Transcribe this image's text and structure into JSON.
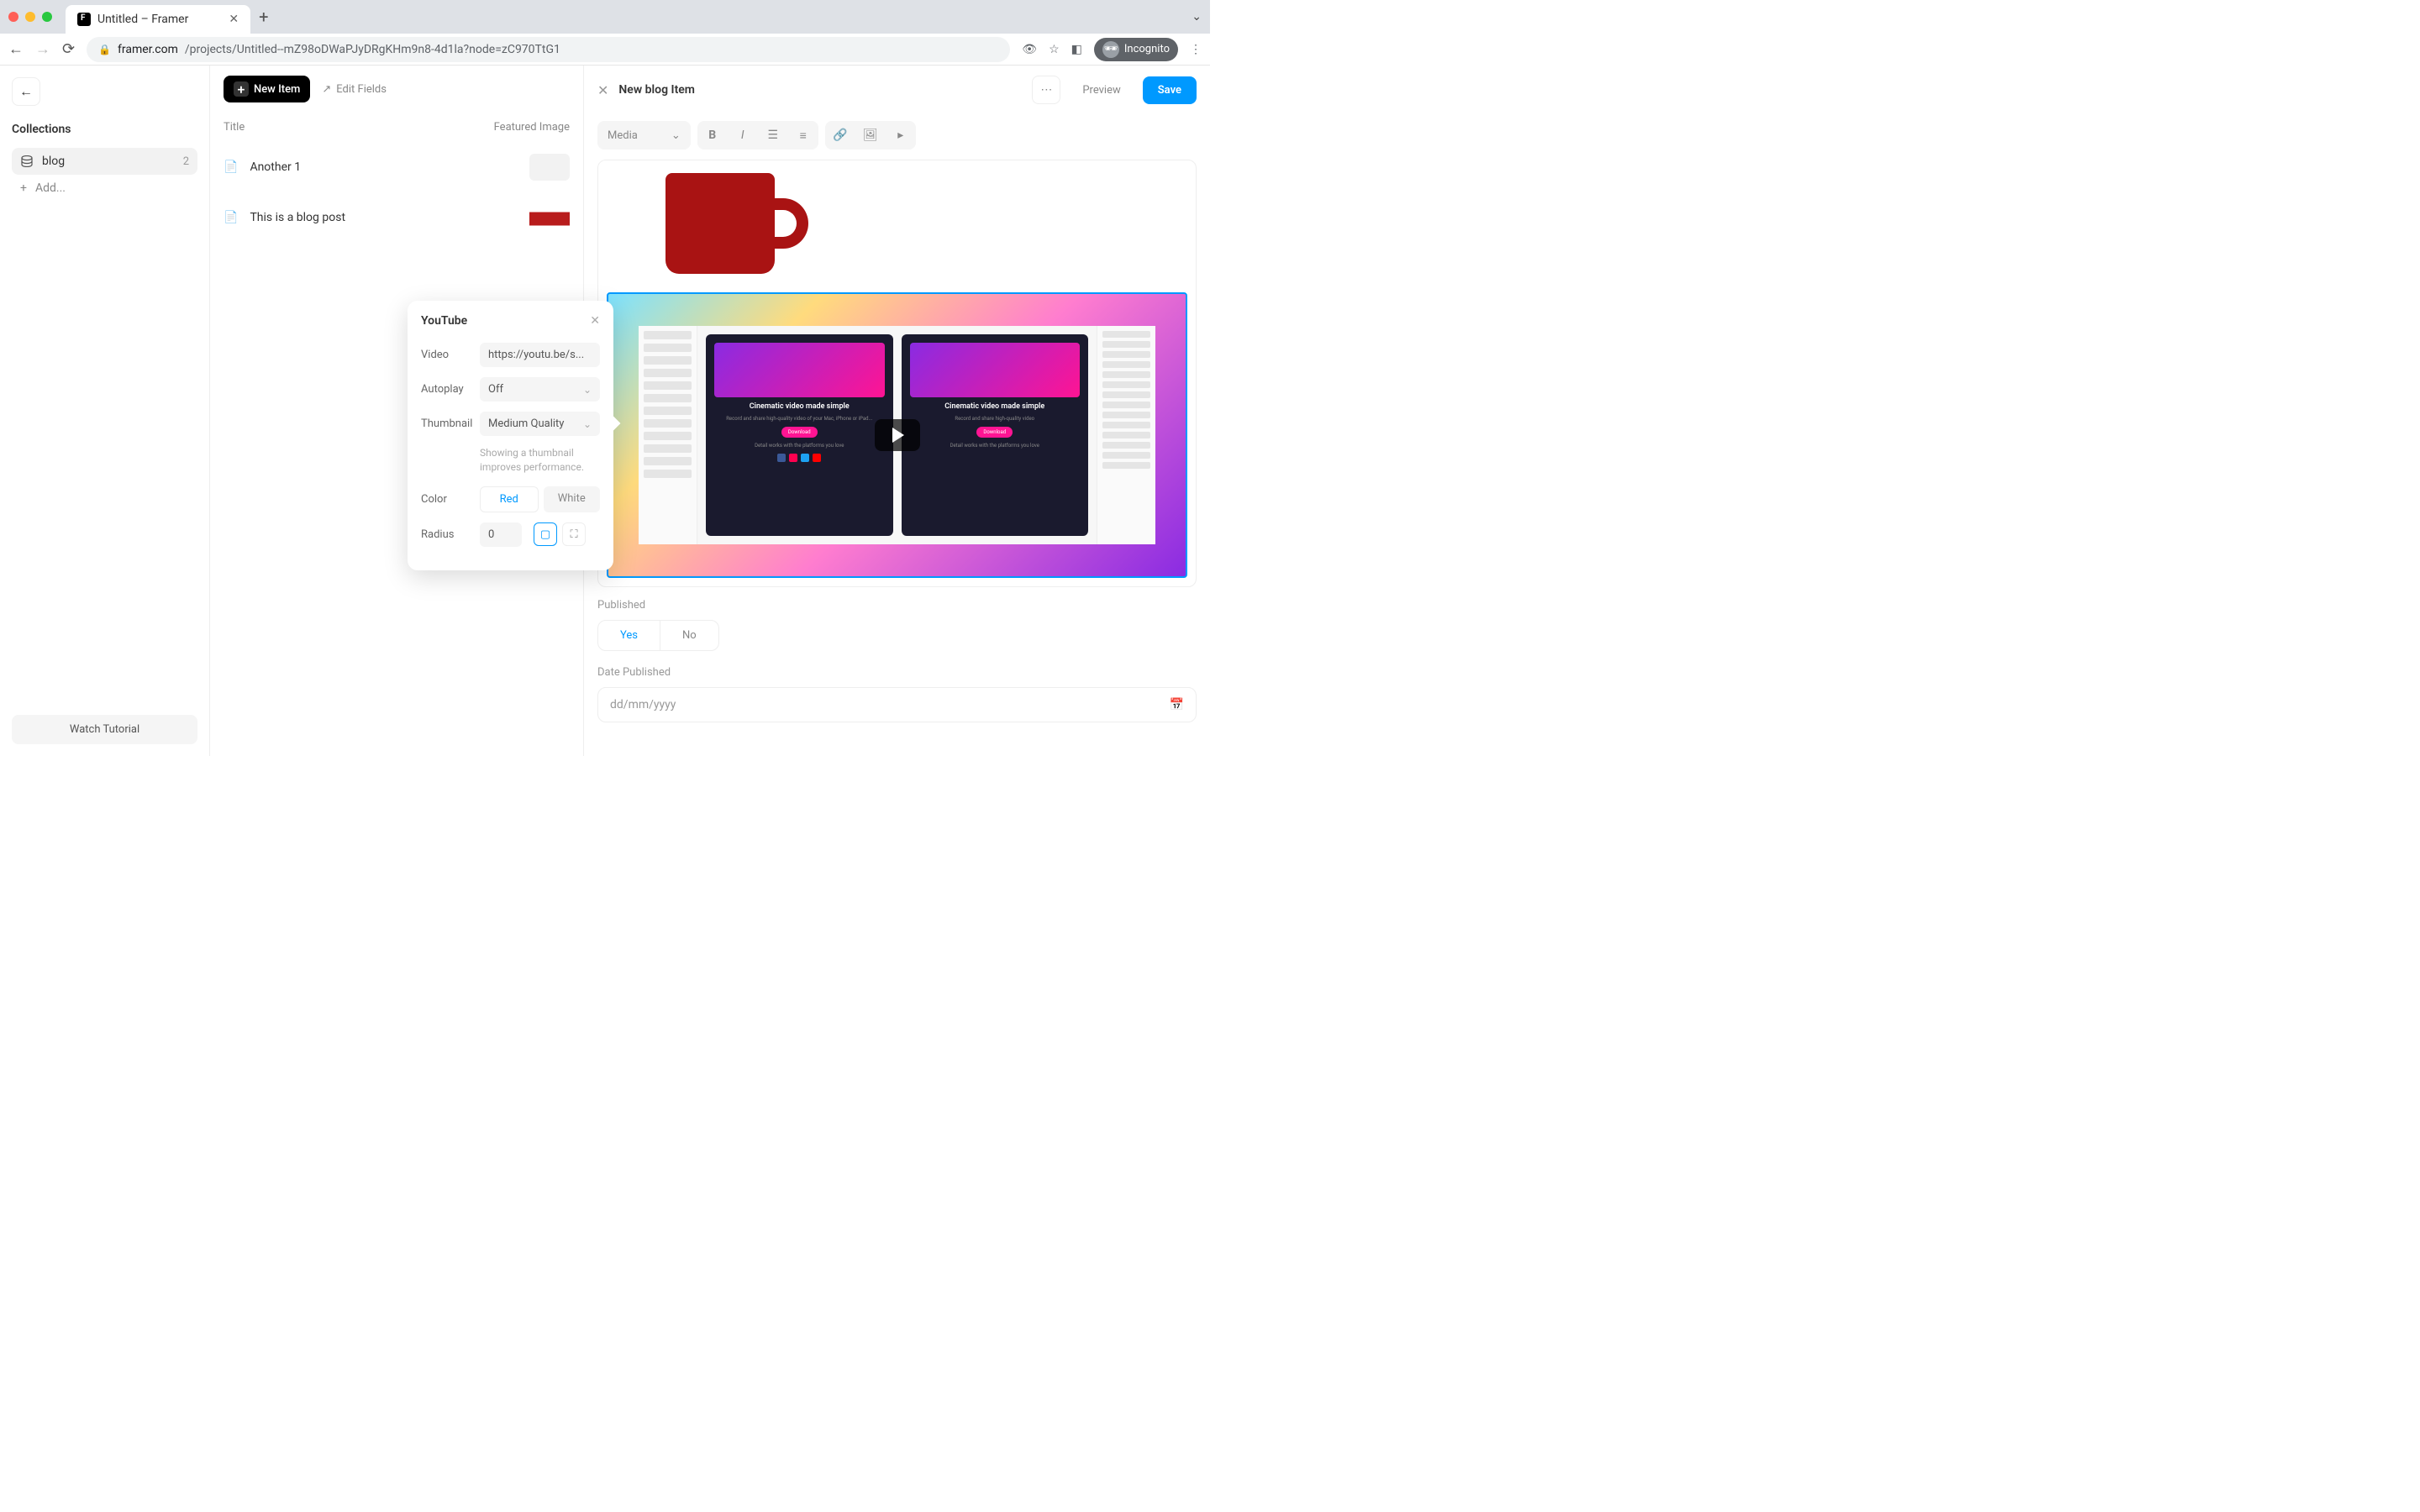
{
  "browser": {
    "tab_title": "Untitled – Framer",
    "url_domain": "framer.com",
    "url_path": "/projects/Untitled--mZ98oDWaPJyDRgKHm9n8-4d1la?node=zC970TtG1",
    "incognito_label": "Incognito"
  },
  "sidebar": {
    "collections_heading": "Collections",
    "items": [
      {
        "name": "blog",
        "count": "2"
      }
    ],
    "add_label": "Add...",
    "tutorial_label": "Watch Tutorial"
  },
  "mid": {
    "new_item_label": "New Item",
    "edit_fields_label": "Edit Fields",
    "col_title": "Title",
    "col_image": "Featured Image",
    "rows": [
      {
        "title": "Another 1"
      },
      {
        "title": "This is a blog post"
      }
    ]
  },
  "popover": {
    "title": "YouTube",
    "video_label": "Video",
    "video_value": "https://youtu.be/s...",
    "autoplay_label": "Autoplay",
    "autoplay_value": "Off",
    "thumbnail_label": "Thumbnail",
    "thumbnail_value": "Medium Quality",
    "hint": "Showing a thumbnail improves performance.",
    "color_label": "Color",
    "color_opt_red": "Red",
    "color_opt_white": "White",
    "radius_label": "Radius",
    "radius_value": "0"
  },
  "editor": {
    "panel_title": "New blog Item",
    "preview_label": "Preview",
    "save_label": "Save",
    "media_dropdown": "Media",
    "video_card_title_1": "Cinematic video made simple",
    "video_card_title_2": "Cinematic video made simple",
    "video_card_sub_1": "Detail works with the platforms you love",
    "video_card_sub_2": "Detail works with the platforms you love",
    "published_label": "Published",
    "published_yes": "Yes",
    "published_no": "No",
    "date_label": "Date Published",
    "date_placeholder": "dd/mm/yyyy"
  }
}
